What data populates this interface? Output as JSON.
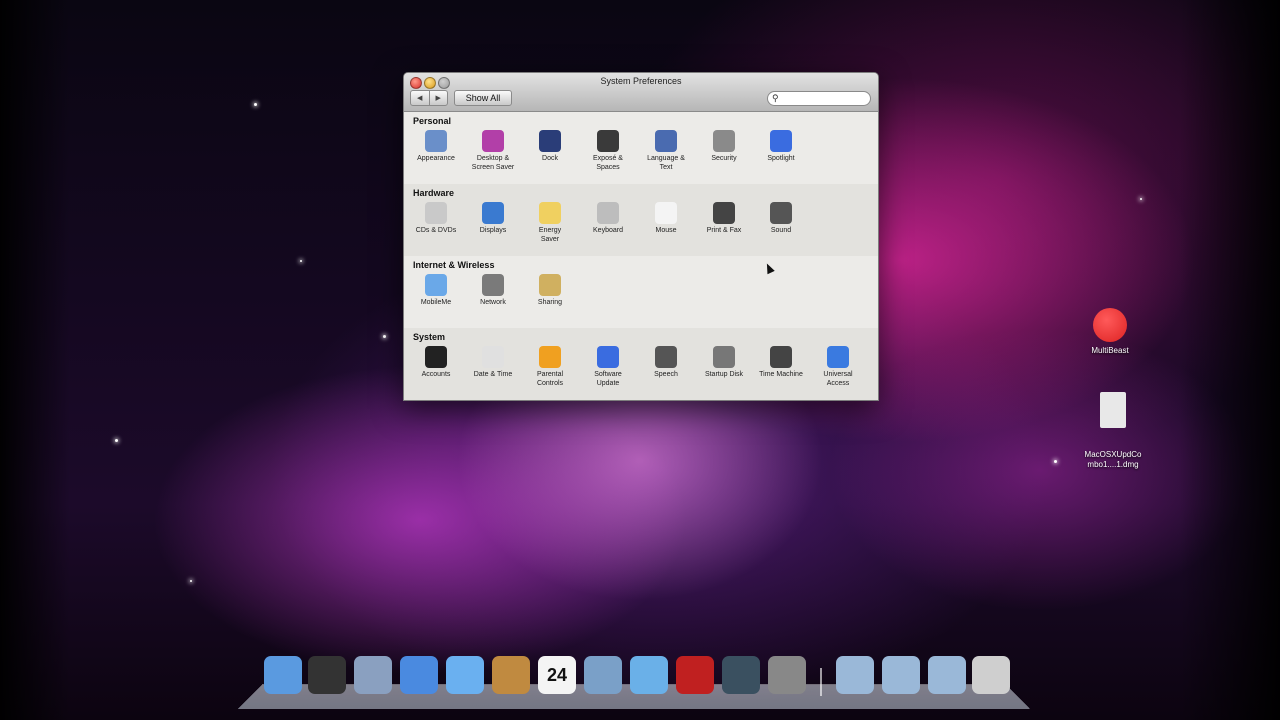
{
  "window": {
    "title": "System Preferences",
    "show_all": "Show All",
    "back": "◀",
    "forward": "▶",
    "search_placeholder": ""
  },
  "sections": [
    {
      "title": "Personal",
      "panes": [
        {
          "label": "Appearance",
          "icon": "appearance-icon",
          "color": "#6a8fc9"
        },
        {
          "label": "Desktop &\nScreen Saver",
          "icon": "desktop-icon",
          "color": "#b23fa8"
        },
        {
          "label": "Dock",
          "icon": "dock-icon",
          "color": "#2a3d78"
        },
        {
          "label": "Exposé &\nSpaces",
          "icon": "expose-icon",
          "color": "#3a3a3a"
        },
        {
          "label": "Language &\nText",
          "icon": "language-icon",
          "color": "#4a6bb0"
        },
        {
          "label": "Security",
          "icon": "security-icon",
          "color": "#8a8a8a"
        },
        {
          "label": "Spotlight",
          "icon": "spotlight-icon",
          "color": "#3a6ce0"
        }
      ]
    },
    {
      "title": "Hardware",
      "panes": [
        {
          "label": "CDs & DVDs",
          "icon": "cd-icon",
          "color": "#c9c9c9"
        },
        {
          "label": "Displays",
          "icon": "displays-icon",
          "color": "#3a7ad0"
        },
        {
          "label": "Energy\nSaver",
          "icon": "energy-icon",
          "color": "#f0d060"
        },
        {
          "label": "Keyboard",
          "icon": "keyboard-icon",
          "color": "#bdbdbd"
        },
        {
          "label": "Mouse",
          "icon": "mouse-icon",
          "color": "#f4f4f4"
        },
        {
          "label": "Print & Fax",
          "icon": "printer-icon",
          "color": "#444"
        },
        {
          "label": "Sound",
          "icon": "sound-icon",
          "color": "#555"
        }
      ]
    },
    {
      "title": "Internet & Wireless",
      "panes": [
        {
          "label": "MobileMe",
          "icon": "mobileme-icon",
          "color": "#6aa8e8"
        },
        {
          "label": "Network",
          "icon": "network-icon",
          "color": "#7a7a7a"
        },
        {
          "label": "Sharing",
          "icon": "sharing-icon",
          "color": "#d0b060"
        }
      ]
    },
    {
      "title": "System",
      "panes": [
        {
          "label": "Accounts",
          "icon": "accounts-icon",
          "color": "#222"
        },
        {
          "label": "Date & Time",
          "icon": "clock-icon",
          "color": "#e0e0e0"
        },
        {
          "label": "Parental\nControls",
          "icon": "parental-icon",
          "color": "#f0a020"
        },
        {
          "label": "Software\nUpdate",
          "icon": "update-icon",
          "color": "#3a6ce0"
        },
        {
          "label": "Speech",
          "icon": "microphone-icon",
          "color": "#555"
        },
        {
          "label": "Startup Disk",
          "icon": "disk-icon",
          "color": "#777"
        },
        {
          "label": "Time Machine",
          "icon": "time-machine-icon",
          "color": "#444"
        },
        {
          "label": "Universal\nAccess",
          "icon": "universal-access-icon",
          "color": "#3a7ae0"
        }
      ]
    }
  ],
  "desktop": [
    {
      "label": "MultiBeast",
      "icon": "apple-icon",
      "color": "#d22"
    },
    {
      "label": "MacOSXUpdCo\nmbo1....1.dmg",
      "icon": "dmg-file-icon",
      "color": "#e8e8e8"
    }
  ],
  "dock": [
    {
      "icon": "finder-icon",
      "color": "#5a9ae0"
    },
    {
      "icon": "dashboard-icon",
      "color": "#333"
    },
    {
      "icon": "mail-icon",
      "color": "#8aa0c0"
    },
    {
      "icon": "safari-icon",
      "color": "#4a8ae0"
    },
    {
      "icon": "ichat-icon",
      "color": "#6ab0f0"
    },
    {
      "icon": "address-book-icon",
      "color": "#c08a40"
    },
    {
      "icon": "ical-icon",
      "color": "#f4f4f4",
      "text": "24"
    },
    {
      "icon": "iphoto-icon",
      "color": "#7aa0c8"
    },
    {
      "icon": "itunes-icon",
      "color": "#6ab0e8"
    },
    {
      "icon": "photo-booth-icon",
      "color": "#c02020"
    },
    {
      "icon": "time-machine-dock-icon",
      "color": "#3a5060"
    },
    {
      "icon": "system-preferences-icon",
      "color": "#888"
    },
    {
      "icon": "applications-folder-icon",
      "color": "#9ab8d8"
    },
    {
      "icon": "documents-folder-icon",
      "color": "#9ab8d8"
    },
    {
      "icon": "downloads-folder-icon",
      "color": "#9ab8d8"
    },
    {
      "icon": "trash-icon",
      "color": "#cfcfcf"
    }
  ]
}
